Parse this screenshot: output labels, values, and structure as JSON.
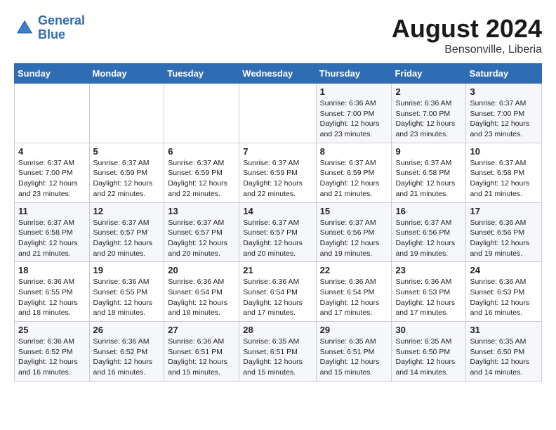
{
  "header": {
    "logo_line1": "General",
    "logo_line2": "Blue",
    "month_year": "August 2024",
    "location": "Bensonville, Liberia"
  },
  "weekdays": [
    "Sunday",
    "Monday",
    "Tuesday",
    "Wednesday",
    "Thursday",
    "Friday",
    "Saturday"
  ],
  "weeks": [
    [
      {
        "day": "",
        "info": ""
      },
      {
        "day": "",
        "info": ""
      },
      {
        "day": "",
        "info": ""
      },
      {
        "day": "",
        "info": ""
      },
      {
        "day": "1",
        "info": "Sunrise: 6:36 AM\nSunset: 7:00 PM\nDaylight: 12 hours\nand 23 minutes."
      },
      {
        "day": "2",
        "info": "Sunrise: 6:36 AM\nSunset: 7:00 PM\nDaylight: 12 hours\nand 23 minutes."
      },
      {
        "day": "3",
        "info": "Sunrise: 6:37 AM\nSunset: 7:00 PM\nDaylight: 12 hours\nand 23 minutes."
      }
    ],
    [
      {
        "day": "4",
        "info": "Sunrise: 6:37 AM\nSunset: 7:00 PM\nDaylight: 12 hours\nand 23 minutes."
      },
      {
        "day": "5",
        "info": "Sunrise: 6:37 AM\nSunset: 6:59 PM\nDaylight: 12 hours\nand 22 minutes."
      },
      {
        "day": "6",
        "info": "Sunrise: 6:37 AM\nSunset: 6:59 PM\nDaylight: 12 hours\nand 22 minutes."
      },
      {
        "day": "7",
        "info": "Sunrise: 6:37 AM\nSunset: 6:59 PM\nDaylight: 12 hours\nand 22 minutes."
      },
      {
        "day": "8",
        "info": "Sunrise: 6:37 AM\nSunset: 6:59 PM\nDaylight: 12 hours\nand 21 minutes."
      },
      {
        "day": "9",
        "info": "Sunrise: 6:37 AM\nSunset: 6:58 PM\nDaylight: 12 hours\nand 21 minutes."
      },
      {
        "day": "10",
        "info": "Sunrise: 6:37 AM\nSunset: 6:58 PM\nDaylight: 12 hours\nand 21 minutes."
      }
    ],
    [
      {
        "day": "11",
        "info": "Sunrise: 6:37 AM\nSunset: 6:58 PM\nDaylight: 12 hours\nand 21 minutes."
      },
      {
        "day": "12",
        "info": "Sunrise: 6:37 AM\nSunset: 6:57 PM\nDaylight: 12 hours\nand 20 minutes."
      },
      {
        "day": "13",
        "info": "Sunrise: 6:37 AM\nSunset: 6:57 PM\nDaylight: 12 hours\nand 20 minutes."
      },
      {
        "day": "14",
        "info": "Sunrise: 6:37 AM\nSunset: 6:57 PM\nDaylight: 12 hours\nand 20 minutes."
      },
      {
        "day": "15",
        "info": "Sunrise: 6:37 AM\nSunset: 6:56 PM\nDaylight: 12 hours\nand 19 minutes."
      },
      {
        "day": "16",
        "info": "Sunrise: 6:37 AM\nSunset: 6:56 PM\nDaylight: 12 hours\nand 19 minutes."
      },
      {
        "day": "17",
        "info": "Sunrise: 6:36 AM\nSunset: 6:56 PM\nDaylight: 12 hours\nand 19 minutes."
      }
    ],
    [
      {
        "day": "18",
        "info": "Sunrise: 6:36 AM\nSunset: 6:55 PM\nDaylight: 12 hours\nand 18 minutes."
      },
      {
        "day": "19",
        "info": "Sunrise: 6:36 AM\nSunset: 6:55 PM\nDaylight: 12 hours\nand 18 minutes."
      },
      {
        "day": "20",
        "info": "Sunrise: 6:36 AM\nSunset: 6:54 PM\nDaylight: 12 hours\nand 18 minutes."
      },
      {
        "day": "21",
        "info": "Sunrise: 6:36 AM\nSunset: 6:54 PM\nDaylight: 12 hours\nand 17 minutes."
      },
      {
        "day": "22",
        "info": "Sunrise: 6:36 AM\nSunset: 6:54 PM\nDaylight: 12 hours\nand 17 minutes."
      },
      {
        "day": "23",
        "info": "Sunrise: 6:36 AM\nSunset: 6:53 PM\nDaylight: 12 hours\nand 17 minutes."
      },
      {
        "day": "24",
        "info": "Sunrise: 6:36 AM\nSunset: 6:53 PM\nDaylight: 12 hours\nand 16 minutes."
      }
    ],
    [
      {
        "day": "25",
        "info": "Sunrise: 6:36 AM\nSunset: 6:52 PM\nDaylight: 12 hours\nand 16 minutes."
      },
      {
        "day": "26",
        "info": "Sunrise: 6:36 AM\nSunset: 6:52 PM\nDaylight: 12 hours\nand 16 minutes."
      },
      {
        "day": "27",
        "info": "Sunrise: 6:36 AM\nSunset: 6:51 PM\nDaylight: 12 hours\nand 15 minutes."
      },
      {
        "day": "28",
        "info": "Sunrise: 6:35 AM\nSunset: 6:51 PM\nDaylight: 12 hours\nand 15 minutes."
      },
      {
        "day": "29",
        "info": "Sunrise: 6:35 AM\nSunset: 6:51 PM\nDaylight: 12 hours\nand 15 minutes."
      },
      {
        "day": "30",
        "info": "Sunrise: 6:35 AM\nSunset: 6:50 PM\nDaylight: 12 hours\nand 14 minutes."
      },
      {
        "day": "31",
        "info": "Sunrise: 6:35 AM\nSunset: 6:50 PM\nDaylight: 12 hours\nand 14 minutes."
      }
    ]
  ]
}
